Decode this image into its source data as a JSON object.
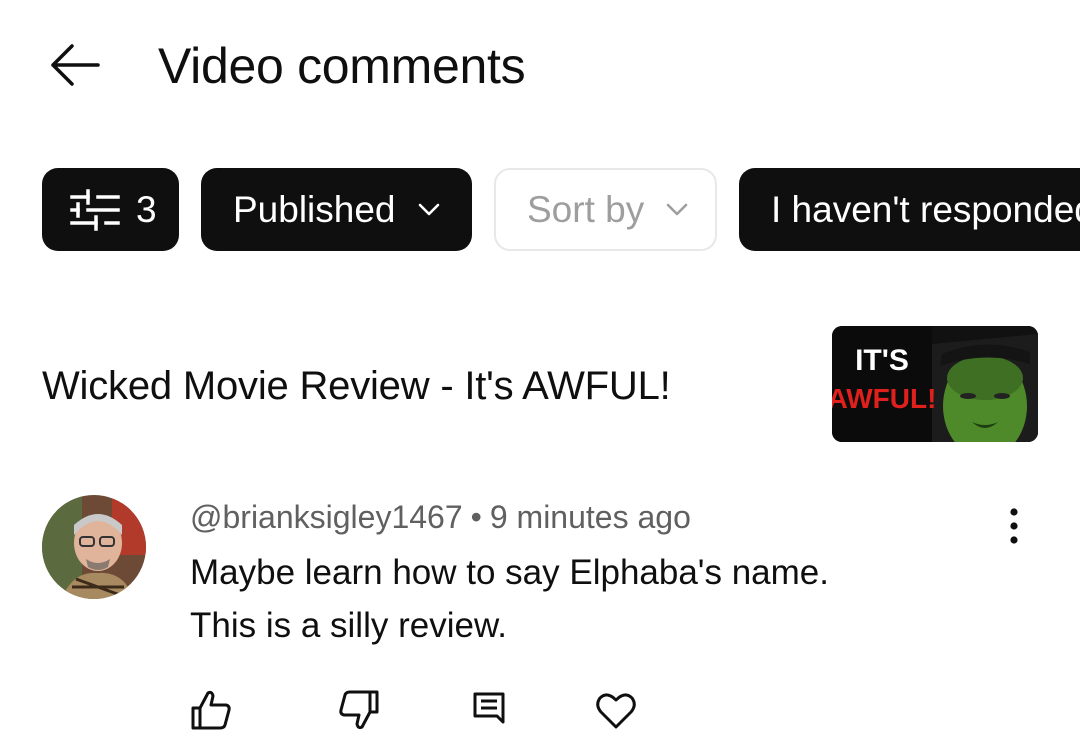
{
  "header": {
    "title": "Video comments",
    "back_icon": "arrow-left-icon"
  },
  "filters": {
    "filter_count": "3",
    "published_label": "Published",
    "sort_label": "Sort by",
    "unresponded_label": "I haven't responded"
  },
  "video": {
    "title": "Wicked Movie Review - It's AWFUL!",
    "thumbnail_text_line1": "IT'S",
    "thumbnail_text_line2": "AWFUL!"
  },
  "comment": {
    "author": "@brianksigley1467",
    "separator": "•",
    "time": "9 minutes ago",
    "lines": [
      "Maybe learn how to say Elphaba's name.",
      "This is a silly review."
    ]
  },
  "actions": [
    "thumbs-up-icon",
    "thumbs-down-icon",
    "reply-icon",
    "heart-icon",
    "more-vert-icon"
  ],
  "colors": {
    "chip_dark": "#0f0f0f",
    "meta_text": "#606060",
    "thumb_red": "#e0201c",
    "thumb_green": "#4f8a2a"
  }
}
